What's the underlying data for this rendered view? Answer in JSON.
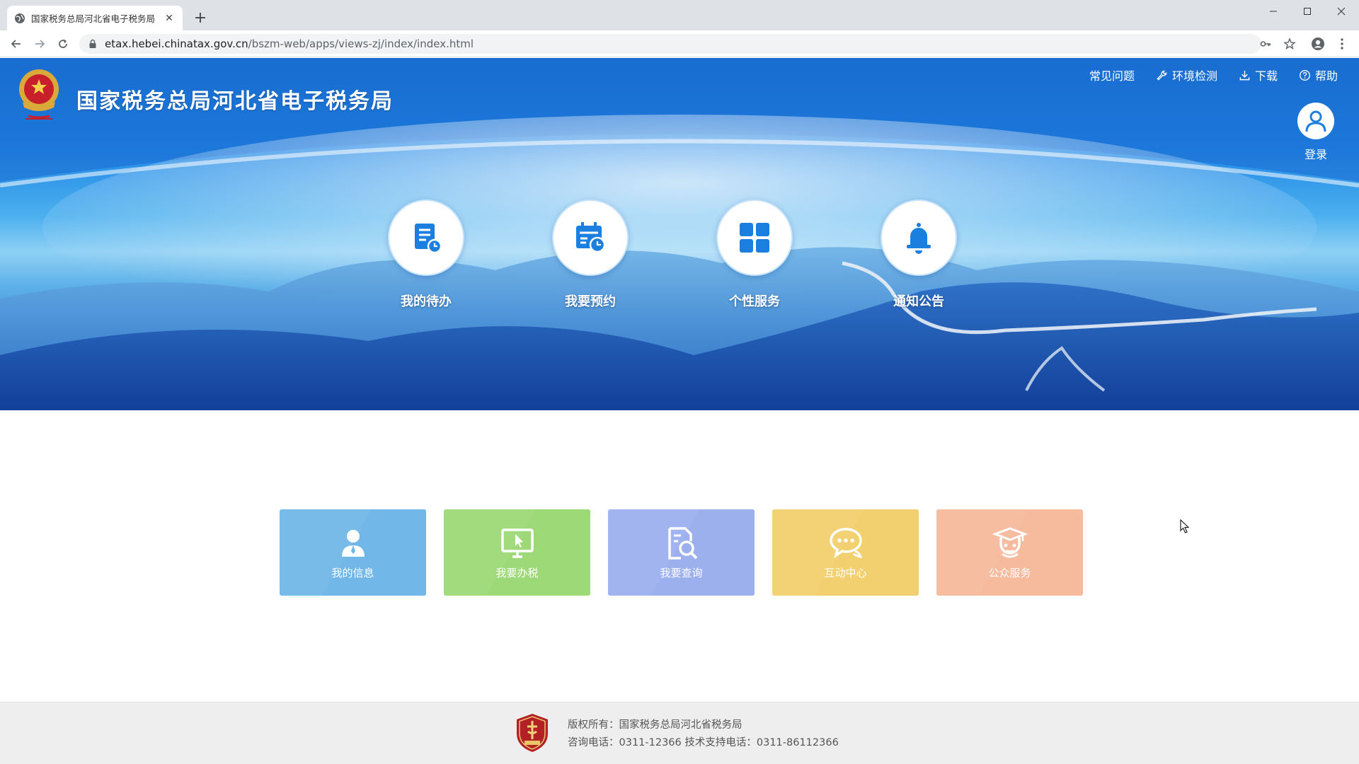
{
  "browser": {
    "tab_title": "国家税务总局河北省电子税务局",
    "url_host": "etax.hebei.chinatax.gov.cn",
    "url_path": "/bszm-web/apps/views-zj/index/index.html"
  },
  "header": {
    "site_title": "国家税务总局河北省电子税务局",
    "links": [
      {
        "label": "常见问题",
        "icon": "none"
      },
      {
        "label": "环境检测",
        "icon": "wrench-icon"
      },
      {
        "label": "下载",
        "icon": "download-icon"
      },
      {
        "label": "帮助",
        "icon": "help-circle-icon"
      }
    ],
    "login_label": "登录"
  },
  "quick_entries": [
    {
      "label": "我的待办",
      "icon": "todo-document-icon"
    },
    {
      "label": "我要预约",
      "icon": "calendar-clock-icon"
    },
    {
      "label": "个性服务",
      "icon": "grid-icon"
    },
    {
      "label": "通知公告",
      "icon": "bell-icon"
    }
  ],
  "cards": [
    {
      "label": "我的信息",
      "icon": "user-icon",
      "color": "#6db6e8"
    },
    {
      "label": "我要办税",
      "icon": "monitor-cursor-icon",
      "color": "#9bd873"
    },
    {
      "label": "我要查询",
      "icon": "document-search-icon",
      "color": "#9aaeee"
    },
    {
      "label": "互动中心",
      "icon": "chat-bubble-icon",
      "color": "#f2cf6b"
    },
    {
      "label": "公众服务",
      "icon": "graduate-icon",
      "color": "#f6b89a"
    }
  ],
  "footer": {
    "copyright": "版权所有：国家税务总局河北省税务局",
    "contact": "咨询电话：0311-12366  技术支持电话：0311-86112366"
  },
  "colors": {
    "brand_blue": "#1f7fe0",
    "icon_blue": "#1b7fe0"
  }
}
